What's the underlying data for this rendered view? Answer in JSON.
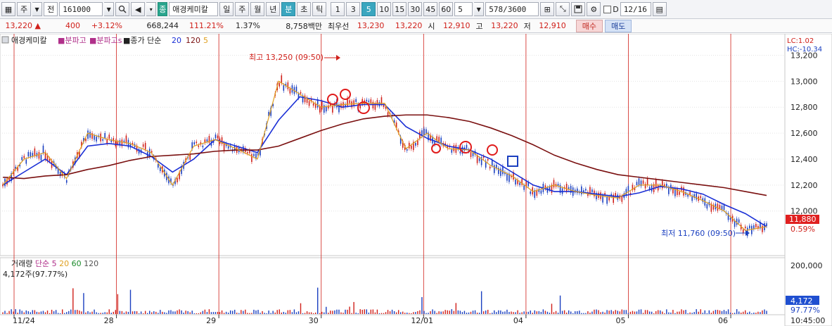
{
  "toolbar": {
    "market": "주",
    "prev_label": "전",
    "code": "161000",
    "name": "애경케미칼",
    "periods": [
      "일",
      "주",
      "월",
      "년",
      "분",
      "초",
      "틱"
    ],
    "intervals": [
      "1",
      "3",
      "5",
      "10",
      "15",
      "30",
      "45",
      "60"
    ],
    "interval_value": "5",
    "count": "578",
    "count_total": "/3600",
    "date_prefix": "D",
    "date": "12/16",
    "icons": [
      "search-icon",
      "speaker-icon",
      "chart-type-icon",
      "zoom-icon",
      "save-icon",
      "settings-icon",
      "calendar-icon"
    ]
  },
  "quote": {
    "price": "13,220",
    "change": "400",
    "change_pct": "+3.12%",
    "volume": "668,244",
    "vol_ratio": "111.21%",
    "turnover": "1.37%",
    "amount": "8,758백만",
    "best_label": "최우선",
    "best_ask": "13,230",
    "best_bid": "13,220",
    "open_label": "시",
    "open": "12,910",
    "high_label": "고",
    "high": "13,220",
    "low_label": "저",
    "low": "12,910",
    "buy_label": "매수",
    "sell_label": "매도"
  },
  "legend": {
    "name": "애경케미칼",
    "items": [
      "분파고",
      "분파고s",
      "종가 단순",
      "20",
      "120",
      "5"
    ],
    "volume_label": "거래량",
    "volume_ma_label": "단순",
    "volume_ma": [
      "5",
      "20",
      "60",
      "120"
    ],
    "volume_value": "4,172주(97.77%)"
  },
  "annotations": {
    "high": "최고 13,250 (09:50)",
    "low": "최저 11,760 (09:50)",
    "lc": "LC:1.02",
    "hc": "HC:-10.34"
  },
  "axis": {
    "price_ticks": [
      "13,200",
      "13,000",
      "12,800",
      "12,600",
      "12,400",
      "12,200",
      "12,000"
    ],
    "last_price": "11,880",
    "last_pct": "0.59%",
    "volume_tick": "200,000",
    "volume_last": "4,172",
    "volume_pct": "97.77%",
    "dates": [
      "11/24",
      "28",
      "29",
      "30",
      "12/01",
      "04",
      "05",
      "06"
    ],
    "time": "10:45:00"
  },
  "colors": {
    "ma20": "#1a2fd6",
    "ma120": "#7a1010",
    "ma5": "#e0a020",
    "up": "#d0201a",
    "down": "#1a3fc0",
    "accent": "#3aa6bf"
  },
  "chart_data": {
    "type": "line",
    "x_sessions": [
      "11/24",
      "28",
      "29",
      "30",
      "12/01",
      "04",
      "05",
      "06"
    ],
    "ylim": [
      11700,
      13300
    ],
    "series": [
      {
        "name": "20",
        "values": [
          12200,
          12300,
          12400,
          12280,
          12500,
          12520,
          12500,
          12420,
          12300,
          12400,
          12550,
          12500,
          12450,
          12700,
          12880,
          12850,
          12800,
          12820,
          12820,
          12650,
          12560,
          12500,
          12470,
          12400,
          12300,
          12200,
          12150,
          12150,
          12130,
          12110,
          12140,
          12190,
          12170,
          12130,
          12050,
          11980,
          11880
        ]
      },
      {
        "name": "120",
        "values": [
          12260,
          12250,
          12270,
          12280,
          12320,
          12350,
          12390,
          12420,
          12430,
          12440,
          12460,
          12470,
          12470,
          12500,
          12560,
          12620,
          12670,
          12710,
          12730,
          12740,
          12740,
          12720,
          12690,
          12640,
          12580,
          12510,
          12430,
          12370,
          12320,
          12280,
          12260,
          12240,
          12220,
          12200,
          12180,
          12150,
          12120
        ]
      },
      {
        "name": "5",
        "values": [
          12200,
          12400,
          12450,
          12250,
          12600,
          12550,
          12520,
          12450,
          12200,
          12500,
          12550,
          12480,
          12400,
          13000,
          12900,
          12800,
          12820,
          12830,
          12830,
          12480,
          12600,
          12480,
          12470,
          12350,
          12270,
          12150,
          12200,
          12150,
          12120,
          12100,
          12200,
          12200,
          12150,
          12080,
          12000,
          11850,
          11880
        ]
      }
    ]
  }
}
